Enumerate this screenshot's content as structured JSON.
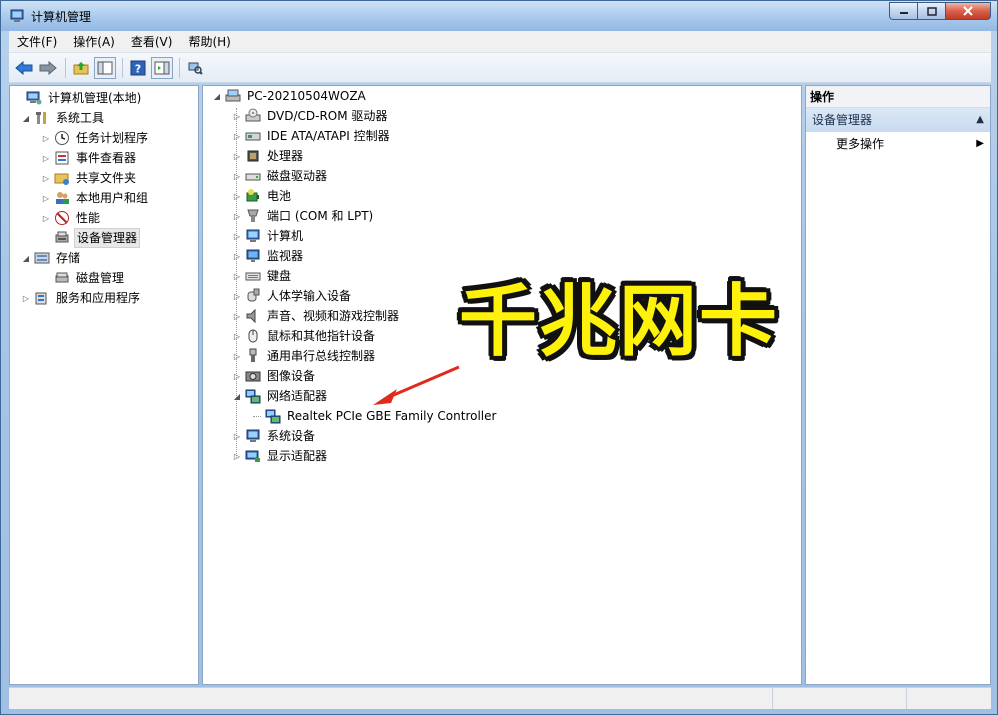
{
  "window": {
    "title": "计算机管理"
  },
  "menu": [
    "文件(F)",
    "操作(A)",
    "查看(V)",
    "帮助(H)"
  ],
  "left_tree": [
    {
      "label": "计算机管理(本地)",
      "level": 0,
      "expander": "none",
      "icon": "computer-management-icon"
    },
    {
      "label": "系统工具",
      "level": 1,
      "expander": "open",
      "icon": "tools-icon"
    },
    {
      "label": "任务计划程序",
      "level": 2,
      "expander": "closed",
      "icon": "clock-icon"
    },
    {
      "label": "事件查看器",
      "level": 2,
      "expander": "closed",
      "icon": "event-viewer-icon"
    },
    {
      "label": "共享文件夹",
      "level": 2,
      "expander": "closed",
      "icon": "shared-folder-icon"
    },
    {
      "label": "本地用户和组",
      "level": 2,
      "expander": "closed",
      "icon": "users-icon"
    },
    {
      "label": "性能",
      "level": 2,
      "expander": "closed",
      "icon": "performance-icon"
    },
    {
      "label": "设备管理器",
      "level": 2,
      "expander": "none",
      "icon": "device-manager-icon",
      "selected": true
    },
    {
      "label": "存储",
      "level": 1,
      "expander": "open",
      "icon": "storage-icon"
    },
    {
      "label": "磁盘管理",
      "level": 2,
      "expander": "none",
      "icon": "disk-icon"
    },
    {
      "label": "服务和应用程序",
      "level": 1,
      "expander": "closed",
      "icon": "services-icon"
    }
  ],
  "device_tree": {
    "root": "PC-20210504WOZA",
    "categories": [
      {
        "label": "DVD/CD-ROM 驱动器",
        "icon": "dvd-drive-icon",
        "expander": "closed"
      },
      {
        "label": "IDE ATA/ATAPI 控制器",
        "icon": "ide-controller-icon",
        "expander": "closed"
      },
      {
        "label": "处理器",
        "icon": "processor-icon",
        "expander": "closed"
      },
      {
        "label": "磁盘驱动器",
        "icon": "disk-drive-icon",
        "expander": "closed"
      },
      {
        "label": "电池",
        "icon": "battery-icon",
        "expander": "closed"
      },
      {
        "label": "端口 (COM 和 LPT)",
        "icon": "port-icon",
        "expander": "closed"
      },
      {
        "label": "计算机",
        "icon": "computer-icon",
        "expander": "closed"
      },
      {
        "label": "监视器",
        "icon": "monitor-icon",
        "expander": "closed"
      },
      {
        "label": "键盘",
        "icon": "keyboard-icon",
        "expander": "closed"
      },
      {
        "label": "人体学输入设备",
        "icon": "hid-icon",
        "expander": "closed"
      },
      {
        "label": "声音、视频和游戏控制器",
        "icon": "speaker-icon",
        "expander": "closed"
      },
      {
        "label": "鼠标和其他指针设备",
        "icon": "mouse-icon",
        "expander": "closed"
      },
      {
        "label": "通用串行总线控制器",
        "icon": "usb-icon",
        "expander": "closed"
      },
      {
        "label": "图像设备",
        "icon": "camera-icon",
        "expander": "closed"
      },
      {
        "label": "网络适配器",
        "icon": "network-adapter-icon",
        "expander": "open",
        "children": [
          "Realtek PCIe GBE Family Controller"
        ]
      },
      {
        "label": "系统设备",
        "icon": "system-device-icon",
        "expander": "closed"
      },
      {
        "label": "显示适配器",
        "icon": "display-adapter-icon",
        "expander": "closed"
      }
    ]
  },
  "actions": {
    "title": "操作",
    "section": "设备管理器",
    "more": "更多操作"
  },
  "annotation": {
    "text": "千兆网卡",
    "color": "#fff20a"
  }
}
